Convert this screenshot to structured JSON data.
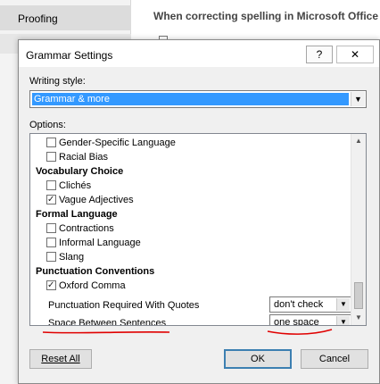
{
  "background": {
    "sidebar_item": "Proofing",
    "heading": "When correcting spelling in Microsoft Office p"
  },
  "dialog": {
    "title": "Grammar Settings",
    "help_label": "?",
    "close_label": "✕",
    "writing_style_label": "Writing style:",
    "writing_style_value": "Grammar & more",
    "options_label": "Options:",
    "list": {
      "items": [
        {
          "kind": "check",
          "label": "Gender-Specific Language",
          "checked": false
        },
        {
          "kind": "check",
          "label": "Racial Bias",
          "checked": false
        },
        {
          "kind": "category",
          "label": "Vocabulary Choice"
        },
        {
          "kind": "check",
          "label": "Clichés",
          "checked": false
        },
        {
          "kind": "check",
          "label": "Vague Adjectives",
          "checked": true
        },
        {
          "kind": "category",
          "label": "Formal Language"
        },
        {
          "kind": "check",
          "label": "Contractions",
          "checked": false
        },
        {
          "kind": "check",
          "label": "Informal Language",
          "checked": false
        },
        {
          "kind": "check",
          "label": "Slang",
          "checked": false
        },
        {
          "kind": "category",
          "label": "Punctuation Conventions"
        },
        {
          "kind": "check",
          "label": "Oxford Comma",
          "checked": true
        }
      ],
      "quotes_label": "Punctuation Required With Quotes",
      "quotes_value": "don't check",
      "spacing_label": "Space Between Sentences",
      "spacing_value": "one space"
    },
    "buttons": {
      "reset": "Reset All",
      "ok": "OK",
      "cancel": "Cancel"
    }
  },
  "colors": {
    "selection": "#3399ff",
    "annotation": "#e00000",
    "default_button_border": "#3c7fb1"
  }
}
